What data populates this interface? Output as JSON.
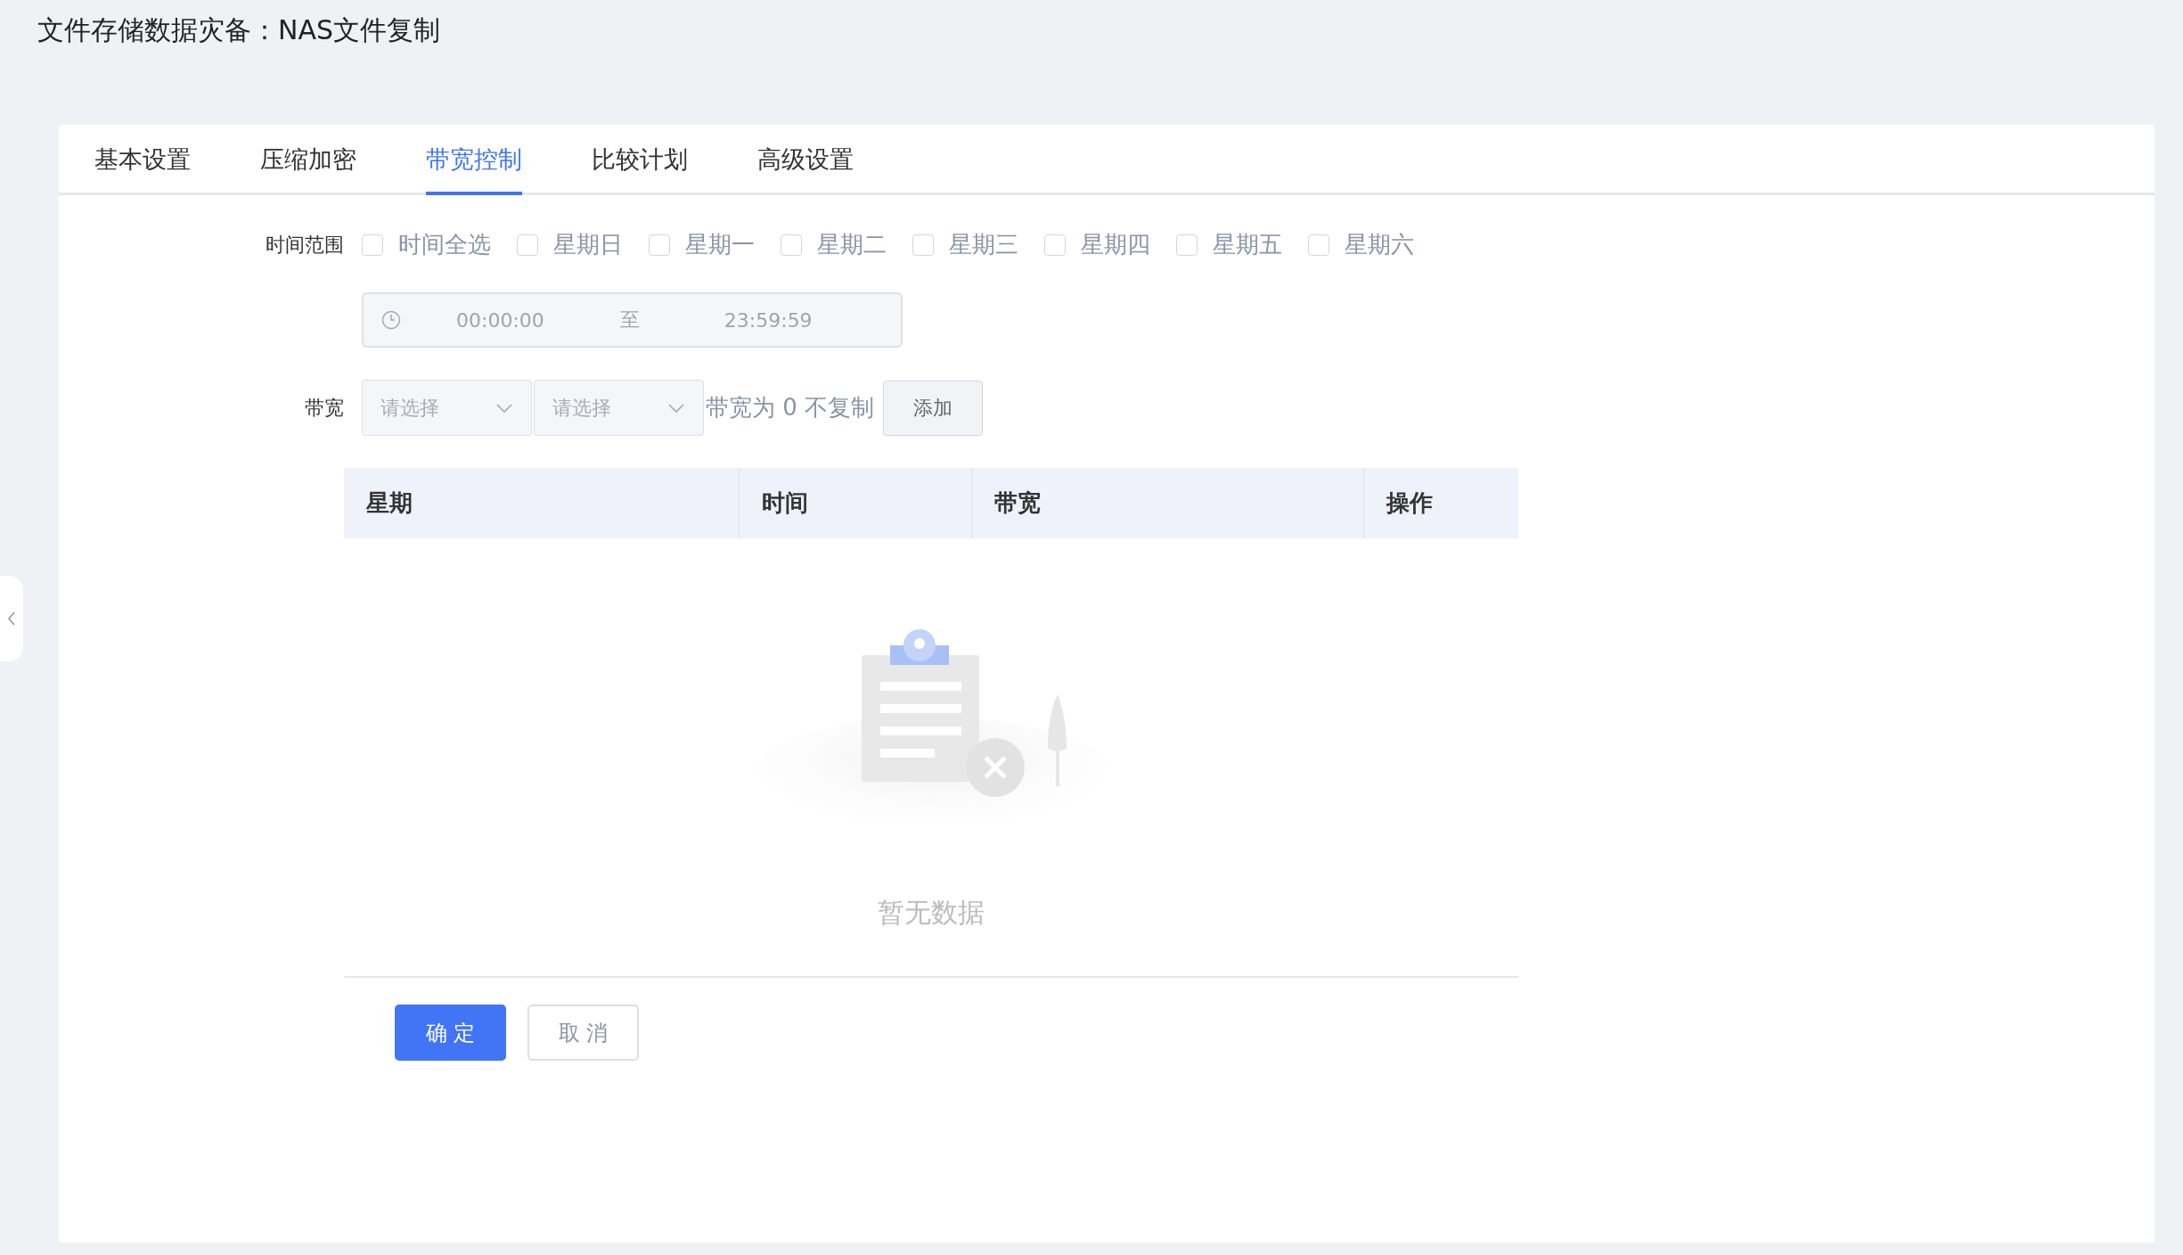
{
  "title": "文件存储数据灾备：NAS文件复制",
  "tabs": [
    {
      "label": "基本设置",
      "selected": false
    },
    {
      "label": "压缩加密",
      "selected": false
    },
    {
      "label": "带宽控制",
      "selected": true
    },
    {
      "label": "比较计划",
      "selected": false
    },
    {
      "label": "高级设置",
      "selected": false
    }
  ],
  "time_range": {
    "label": "时间范围",
    "options": [
      {
        "label": "时间全选",
        "checked": false
      },
      {
        "label": "星期日",
        "checked": false
      },
      {
        "label": "星期一",
        "checked": false
      },
      {
        "label": "星期二",
        "checked": false
      },
      {
        "label": "星期三",
        "checked": false
      },
      {
        "label": "星期四",
        "checked": false
      },
      {
        "label": "星期五",
        "checked": false
      },
      {
        "label": "星期六",
        "checked": false
      }
    ],
    "start": "00:00:00",
    "separator": "至",
    "end": "23:59:59"
  },
  "bandwidth": {
    "label": "带宽",
    "selects": [
      {
        "placeholder": "请选择"
      },
      {
        "placeholder": "请选择"
      }
    ],
    "hint": "带宽为 0 不复制",
    "add_button": "添加"
  },
  "table": {
    "columns": [
      "星期",
      "时间",
      "带宽",
      "操作"
    ],
    "empty_text": "暂无数据"
  },
  "buttons": [
    {
      "label": "确 定",
      "kind": "primary"
    },
    {
      "label": "取 消",
      "kind": "default"
    }
  ]
}
